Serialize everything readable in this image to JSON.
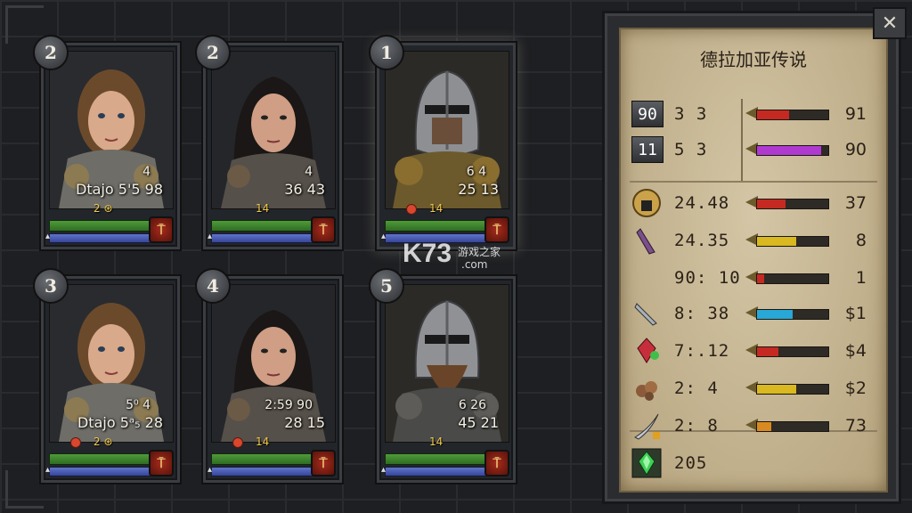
{
  "panel": {
    "title": "德拉加亚传说",
    "close_label": "✕",
    "rows": [
      {
        "icon": "gear-slot-icon",
        "slot": "90",
        "value": "3 3",
        "bar_color": "#c52a22",
        "bar_fill": 0.45,
        "right": "91"
      },
      {
        "icon": "gear-slot-icon",
        "slot": "11",
        "value": "5 3",
        "bar_color": "#b03ad0",
        "bar_fill": 0.9,
        "right": "90"
      },
      {
        "icon": "golden-helm-icon",
        "value": "24.48",
        "bar_color": "#c52a22",
        "bar_fill": 0.4,
        "right": "37"
      },
      {
        "icon": "purple-blade-icon",
        "value": "24.35",
        "bar_color": "#d9b820",
        "bar_fill": 0.55,
        "right": "8"
      },
      {
        "icon": "",
        "value": "90: 10",
        "bar_color": "#c52a22",
        "bar_fill": 0.1,
        "right": "1"
      },
      {
        "icon": "dagger-icon",
        "value": "8: 38",
        "bar_color": "#27a8d6",
        "bar_fill": 0.5,
        "right": "$1"
      },
      {
        "icon": "red-crystal-icon",
        "value": "7:.12",
        "bar_color": "#c52a22",
        "bar_fill": 0.3,
        "right": "$4"
      },
      {
        "icon": "ore-cluster-icon",
        "value": "2: 4",
        "bar_color": "#d9b820",
        "bar_fill": 0.55,
        "right": "$2"
      },
      {
        "icon": "silver-blade-icon",
        "value": "2: 8",
        "bar_color": "#d98a20",
        "bar_fill": 0.2,
        "right": "73"
      }
    ],
    "footer": {
      "icon": "green-gem-icon",
      "value": "205"
    }
  },
  "cards": [
    {
      "badge": "2",
      "top_small": "4",
      "line1": "Dtajo 5'5 98",
      "line2": "",
      "coins": "2 ⊛",
      "heal": false,
      "selected": false,
      "hero": "female-light"
    },
    {
      "badge": "2",
      "top_small": "4",
      "line1": "36  43",
      "line2": "",
      "coins": "14",
      "heal": false,
      "selected": false,
      "hero": "female-dark"
    },
    {
      "badge": "1",
      "top_small": "6  4",
      "line1": "25  13",
      "line2": "",
      "coins": "14",
      "heal": true,
      "selected": true,
      "hero": "knight"
    },
    {
      "badge": "3",
      "top_small": "5⁰  4",
      "line1": "Dtajo 5ᵃ₅ 28",
      "line2": "",
      "coins": "2 ⊛",
      "heal": true,
      "selected": false,
      "hero": "female-light"
    },
    {
      "badge": "4",
      "top_small": "2:59  90",
      "line1": "28  15",
      "line2": "",
      "coins": "14",
      "heal": true,
      "selected": false,
      "hero": "female-dark"
    },
    {
      "badge": "5",
      "top_small": "6  26",
      "line1": "45  21",
      "line2": "",
      "coins": "14",
      "heal": false,
      "selected": false,
      "hero": "knight-bearded"
    }
  ],
  "watermark": {
    "logo": "K73",
    "line1": "游戏之家",
    "line2": ".com"
  }
}
